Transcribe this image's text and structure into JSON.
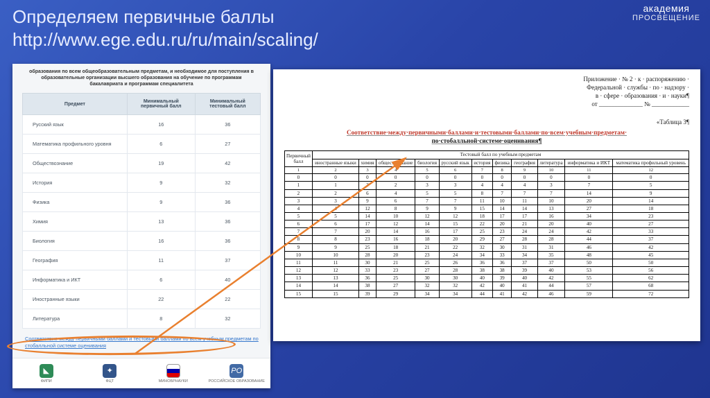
{
  "header": {
    "title": "Определяем первичные баллы",
    "url": "http://www.ege.edu.ru/ru/main/scaling/"
  },
  "logo": {
    "line1": "академия",
    "line2": "ПРОСВЕЩЕНИЕ"
  },
  "left_panel": {
    "intro": "образования по всем общеобразовательным предметам, и необходимое для поступления в образовательные организации высшего образования на обучение по программам бакалавриата и программам специалитета",
    "table_headers": [
      "Предмет",
      "Минимальный первичный балл",
      "Минимальный тестовый балл"
    ],
    "rows": [
      [
        "Русский язык",
        "16",
        "36"
      ],
      [
        "Математика профильного уровня",
        "6",
        "27"
      ],
      [
        "Обществознание",
        "19",
        "42"
      ],
      [
        "История",
        "9",
        "32"
      ],
      [
        "Физика",
        "9",
        "36"
      ],
      [
        "Химия",
        "13",
        "36"
      ],
      [
        "Биология",
        "16",
        "36"
      ],
      [
        "География",
        "11",
        "37"
      ],
      [
        "Информатика и ИКТ",
        "6",
        "40"
      ],
      [
        "Иностранные языки",
        "22",
        "22"
      ],
      [
        "Литература",
        "8",
        "32"
      ]
    ],
    "highlight_link": "Соответствие между первичными баллами и тестовыми баллами по всем учебным предметам по стобалльной системе оценивания",
    "footer": [
      "ФИПИ",
      "ФЦТ",
      "МИНОБРНАУКИ",
      "РОССИЙСКОЕ ОБРАЗОВАНИЕ"
    ]
  },
  "right_panel": {
    "annex": [
      "Приложение · № 2 · к · распоряжению ·",
      "Федеральной · службы · по · надзору ·",
      "в · сфере · образования · и · науки¶",
      "от ______________ № ____________"
    ],
    "table_label": "«Таблица 3¶",
    "doc_title_red": "Соответствие·между·первичными·баллами·и·тестовыми·баллами·по·всем·учебным·предметам·",
    "doc_title_black": "по·стобалльной·системе·оценивания¶",
    "chart_data": {
      "type": "table",
      "row_header": "Первичный балл",
      "group_header": "Тестовый балл по учебным предметам",
      "columns": [
        "иностранные языки",
        "химия",
        "обществознание",
        "биология",
        "русский язык",
        "история",
        "физика",
        "география",
        "литература",
        "информатика и ИКТ",
        "математика профильный уровень"
      ],
      "index_row": [
        "1",
        "2",
        "3",
        "4",
        "5",
        "6",
        "7",
        "8",
        "9",
        "10",
        "11",
        "12"
      ],
      "rows": [
        {
          "pb": "0",
          "v": [
            "0",
            "0",
            "0",
            "0",
            "0",
            "0",
            "0",
            "0",
            "0",
            "0",
            "0"
          ]
        },
        {
          "pb": "1",
          "v": [
            "1",
            "3",
            "2",
            "3",
            "3",
            "4",
            "4",
            "4",
            "3",
            "7",
            "5"
          ]
        },
        {
          "pb": "2",
          "v": [
            "2",
            "6",
            "4",
            "5",
            "5",
            "8",
            "7",
            "7",
            "7",
            "14",
            "9"
          ]
        },
        {
          "pb": "3",
          "v": [
            "3",
            "9",
            "6",
            "7",
            "7",
            "11",
            "10",
            "11",
            "10",
            "20",
            "14"
          ]
        },
        {
          "pb": "4",
          "v": [
            "4",
            "12",
            "8",
            "9",
            "9",
            "15",
            "14",
            "14",
            "13",
            "27",
            "18"
          ]
        },
        {
          "pb": "5",
          "v": [
            "5",
            "14",
            "10",
            "12",
            "12",
            "18",
            "17",
            "17",
            "16",
            "34",
            "23"
          ]
        },
        {
          "pb": "6",
          "v": [
            "6",
            "17",
            "12",
            "14",
            "15",
            "22",
            "20",
            "21",
            "20",
            "40",
            "27"
          ]
        },
        {
          "pb": "7",
          "v": [
            "7",
            "20",
            "14",
            "16",
            "17",
            "25",
            "23",
            "24",
            "24",
            "42",
            "33"
          ]
        },
        {
          "pb": "8",
          "v": [
            "8",
            "23",
            "16",
            "18",
            "20",
            "29",
            "27",
            "28",
            "28",
            "44",
            "37"
          ]
        },
        {
          "pb": "9",
          "v": [
            "9",
            "25",
            "18",
            "21",
            "22",
            "32",
            "30",
            "31",
            "31",
            "46",
            "42"
          ]
        },
        {
          "pb": "10",
          "v": [
            "10",
            "28",
            "20",
            "23",
            "24",
            "34",
            "33",
            "34",
            "35",
            "48",
            "45"
          ]
        },
        {
          "pb": "11",
          "v": [
            "11",
            "30",
            "21",
            "25",
            "26",
            "36",
            "36",
            "37",
            "37",
            "50",
            "50"
          ]
        },
        {
          "pb": "12",
          "v": [
            "12",
            "33",
            "23",
            "27",
            "28",
            "38",
            "38",
            "39",
            "40",
            "53",
            "56"
          ]
        },
        {
          "pb": "13",
          "v": [
            "13",
            "36",
            "25",
            "30",
            "30",
            "40",
            "39",
            "40",
            "42",
            "55",
            "62"
          ]
        },
        {
          "pb": "14",
          "v": [
            "14",
            "38",
            "27",
            "32",
            "32",
            "42",
            "40",
            "41",
            "44",
            "57",
            "68"
          ]
        },
        {
          "pb": "15",
          "v": [
            "15",
            "39",
            "29",
            "34",
            "34",
            "44",
            "41",
            "42",
            "46",
            "59",
            "72"
          ]
        }
      ]
    }
  }
}
